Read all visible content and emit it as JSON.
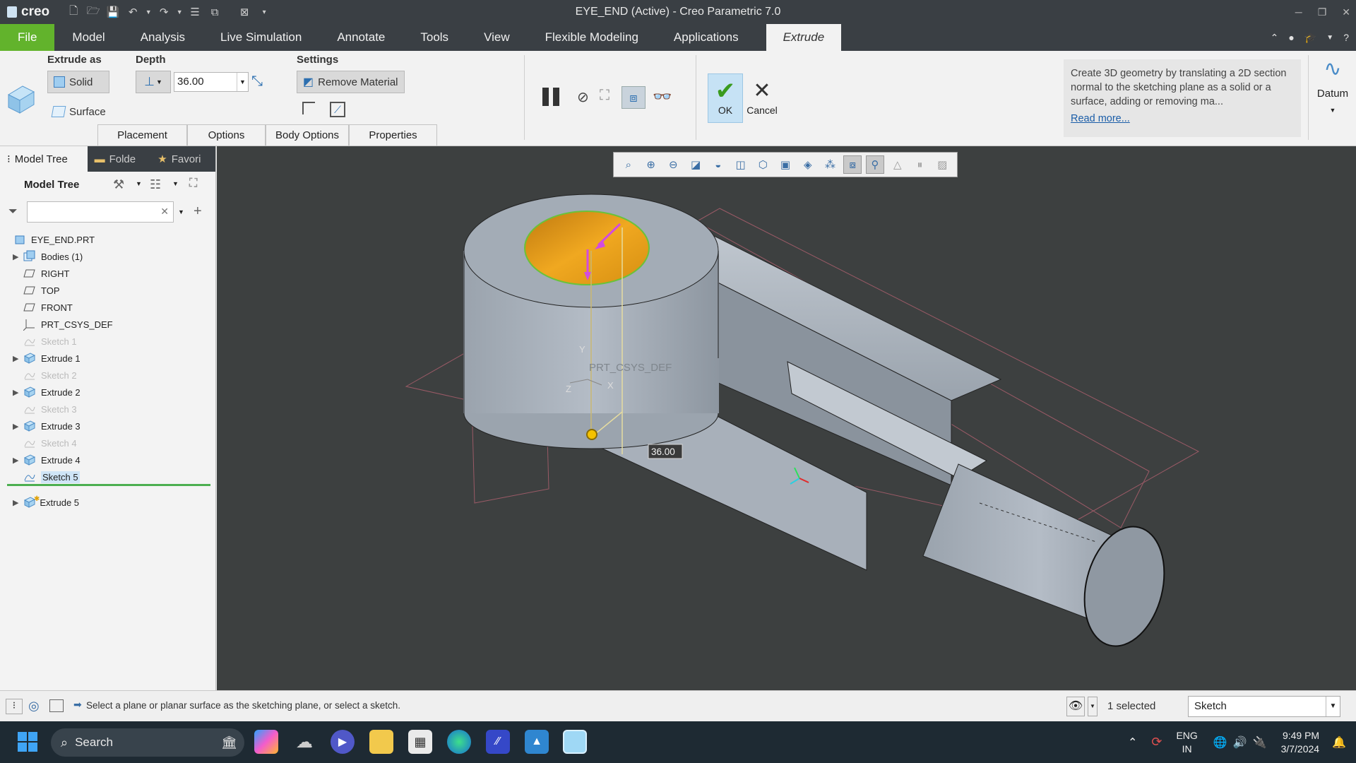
{
  "titlebar": {
    "app_logo": "creo",
    "title": "EYE_END (Active) - Creo Parametric 7.0"
  },
  "menubar": {
    "items": [
      "File",
      "Model",
      "Analysis",
      "Live Simulation",
      "Annotate",
      "Tools",
      "View",
      "Flexible Modeling",
      "Applications",
      "Extrude"
    ]
  },
  "ribbon": {
    "extrude_as_label": "Extrude as",
    "solid_label": "Solid",
    "surface_label": "Surface",
    "depth_label": "Depth",
    "depth_value": "36.00",
    "settings_label": "Settings",
    "remove_material_label": "Remove Material",
    "ok_label": "OK",
    "cancel_label": "Cancel",
    "tabs": [
      "Placement",
      "Options",
      "Body Options",
      "Properties"
    ],
    "help_text": "Create 3D geometry by translating a 2D section normal to the sketching plane as a solid or a surface, adding or removing ma...",
    "read_more": "Read more...",
    "datum_label": "Datum"
  },
  "leftpanel": {
    "tabs": [
      "Model Tree",
      "Folde",
      "Favori"
    ],
    "header": "Model Tree",
    "tree": [
      {
        "label": "EYE_END.PRT",
        "icon": "part-icon",
        "expand": false,
        "dim": false,
        "indent": 0
      },
      {
        "label": "Bodies (1)",
        "icon": "bodies-icon",
        "expand": true,
        "dim": false,
        "indent": 1
      },
      {
        "label": "RIGHT",
        "icon": "plane-icon",
        "expand": false,
        "dim": false,
        "indent": 1
      },
      {
        "label": "TOP",
        "icon": "plane-icon",
        "expand": false,
        "dim": false,
        "indent": 1
      },
      {
        "label": "FRONT",
        "icon": "plane-icon",
        "expand": false,
        "dim": false,
        "indent": 1
      },
      {
        "label": "PRT_CSYS_DEF",
        "icon": "csys-icon",
        "expand": false,
        "dim": false,
        "indent": 1
      },
      {
        "label": "Sketch 1",
        "icon": "sketch-icon",
        "expand": false,
        "dim": true,
        "indent": 1
      },
      {
        "label": "Extrude 1",
        "icon": "extrude-icon",
        "expand": true,
        "dim": false,
        "indent": 1
      },
      {
        "label": "Sketch 2",
        "icon": "sketch-icon",
        "expand": false,
        "dim": true,
        "indent": 1
      },
      {
        "label": "Extrude 2",
        "icon": "extrude-icon",
        "expand": true,
        "dim": false,
        "indent": 1
      },
      {
        "label": "Sketch 3",
        "icon": "sketch-icon",
        "expand": false,
        "dim": true,
        "indent": 1
      },
      {
        "label": "Extrude 3",
        "icon": "extrude-icon",
        "expand": true,
        "dim": false,
        "indent": 1
      },
      {
        "label": "Sketch 4",
        "icon": "sketch-icon",
        "expand": false,
        "dim": true,
        "indent": 1
      },
      {
        "label": "Extrude 4",
        "icon": "extrude-icon",
        "expand": true,
        "dim": false,
        "indent": 1
      },
      {
        "label": "Sketch 5",
        "icon": "sketch-icon",
        "expand": false,
        "dim": false,
        "indent": 1,
        "selected": true
      }
    ],
    "after_insert": {
      "label": "Extrude 5",
      "icon": "extrude-icon",
      "expand": true
    }
  },
  "viewport": {
    "dimension_value": "36.00",
    "csys_label": "PRT_CSYS_DEF",
    "axis_x": "X",
    "axis_y": "Y",
    "axis_z": "Z"
  },
  "statusbar": {
    "message": "Select a plane or planar surface as the sketching plane, or select a sketch.",
    "selected": "1 selected",
    "filter": "Sketch"
  },
  "taskbar": {
    "search_placeholder": "Search",
    "lang_top": "ENG",
    "lang_bottom": "IN",
    "time": "9:49 PM",
    "date": "3/7/2024"
  },
  "colors": {
    "accent_green": "#62b32c",
    "dark_chrome": "#3a3f44",
    "viewport_bg": "#3d4040",
    "model_gray": "#a9b1bb",
    "sketch_orange": "#e8a317"
  }
}
